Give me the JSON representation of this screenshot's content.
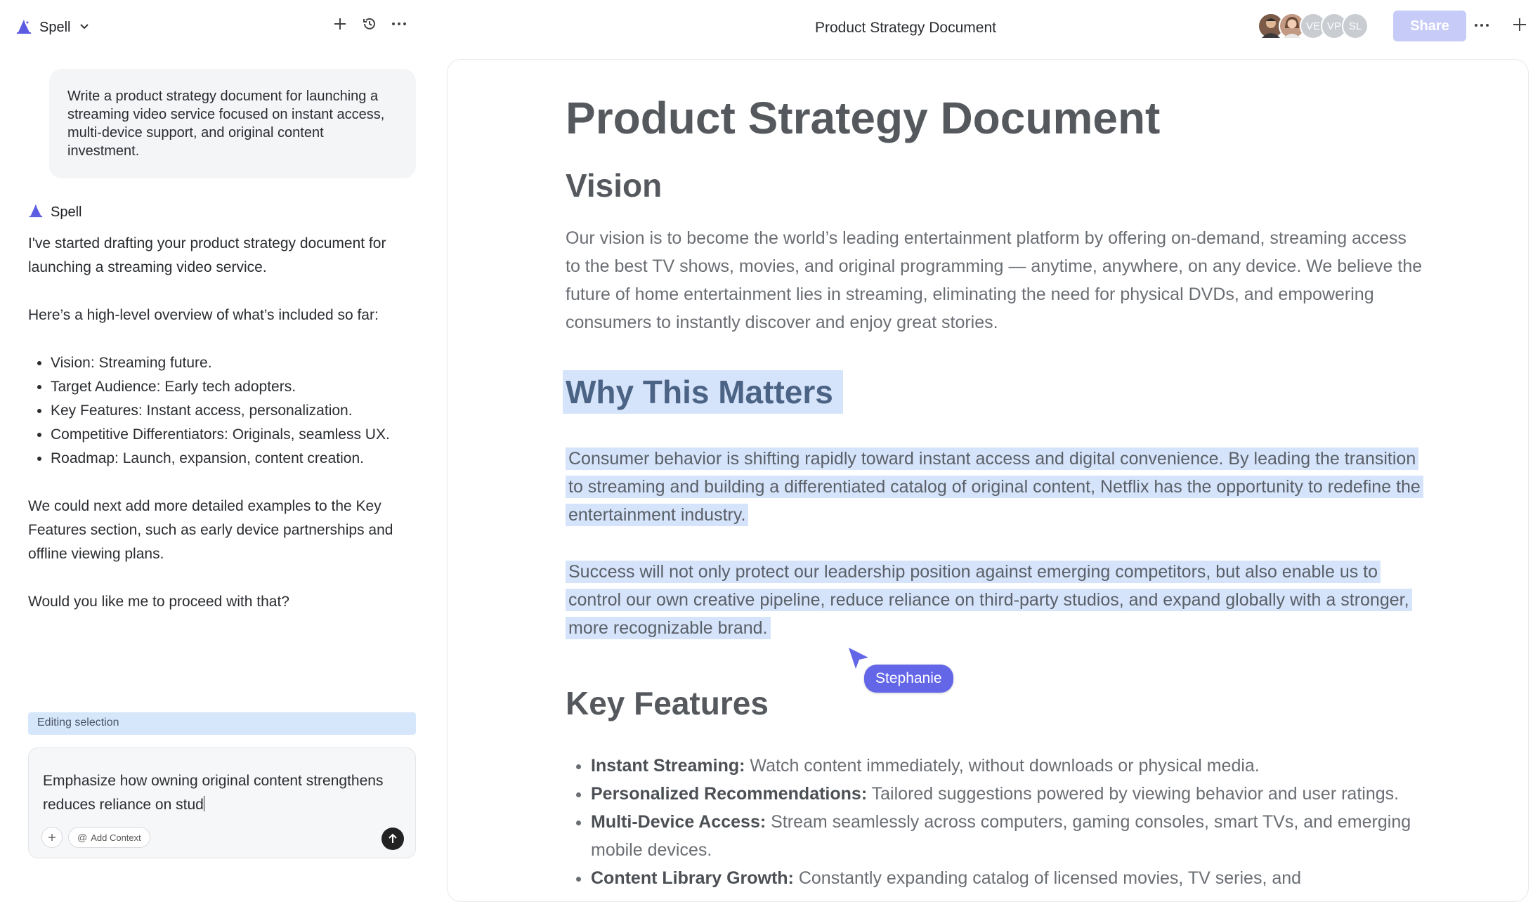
{
  "app": {
    "name": "Spell"
  },
  "conversation": {
    "user_prompt": "Write a product strategy document for launching a streaming video service focused on instant access, multi-device support, and original content investment.",
    "assistant_name": "Spell",
    "response": {
      "intro": "I've started drafting your product strategy document for launching a streaming video service.",
      "overview_label": "Here’s a high-level overview of what’s included so far:",
      "items": [
        "Vision: Streaming future.",
        "Target Audience: Early tech adopters.",
        "Key Features: Instant access, personalization.",
        "Competitive Differentiators: Originals, seamless UX.",
        "Roadmap: Launch, expansion, content creation."
      ],
      "next": "We could next add more detailed examples to the Key Features section, such as early device partnerships and offline viewing plans.",
      "question": "Would you like me to proceed with that?"
    }
  },
  "composer": {
    "editing_label": "Editing selection",
    "text": "Emphasize how owning original content strengthens reduces reliance on stud",
    "add_context": "Add Context"
  },
  "topbar": {
    "doc_title": "Product Strategy Document",
    "share": "Share",
    "avatars": [
      {
        "initials": "",
        "color": "#8a6a55"
      },
      {
        "initials": "",
        "color": "#b98b74"
      },
      {
        "initials": "VE",
        "color": "#c9ccd1"
      },
      {
        "initials": "VP",
        "color": "#c9ccd1"
      },
      {
        "initials": "SL",
        "color": "#c9ccd1"
      }
    ]
  },
  "document": {
    "title": "Product Strategy Document",
    "vision_heading": "Vision",
    "vision_text": "Our vision is to become the world’s leading entertainment platform by offering on-demand, streaming access to the best TV shows, movies, and original programming — anytime, anywhere, on any device. We believe the future of home entertainment lies in streaming, eliminating the need for physical DVDs, and empowering consumers to instantly discover and enjoy great stories.",
    "why_heading": "Why This Matters",
    "why_p1": "Consumer behavior is shifting rapidly toward instant access and digital convenience. By leading the transition to streaming and building a differentiated catalog of original content, Netflix has the opportunity to redefine the entertainment industry.",
    "why_p2": "Success will not only protect our leadership position against emerging competitors, but also enable us to control our own creative pipeline, reduce reliance on third-party studios, and expand globally with a stronger, more recognizable brand.",
    "features_heading": "Key Features",
    "features": [
      {
        "label": "Instant Streaming:",
        "text": " Watch content immediately, without downloads or physical media."
      },
      {
        "label": "Personalized Recommendations:",
        "text": " Tailored suggestions powered by viewing behavior and user ratings."
      },
      {
        "label": "Multi-Device Access:",
        "text": " Stream seamlessly across computers, gaming consoles, smart TVs, and emerging mobile devices."
      },
      {
        "label": "Content Library Growth:",
        "text": " Constantly expanding catalog of licensed movies, TV series, and"
      }
    ]
  },
  "collaborator_cursor": {
    "name": "Stephanie",
    "color": "#6466e8"
  }
}
